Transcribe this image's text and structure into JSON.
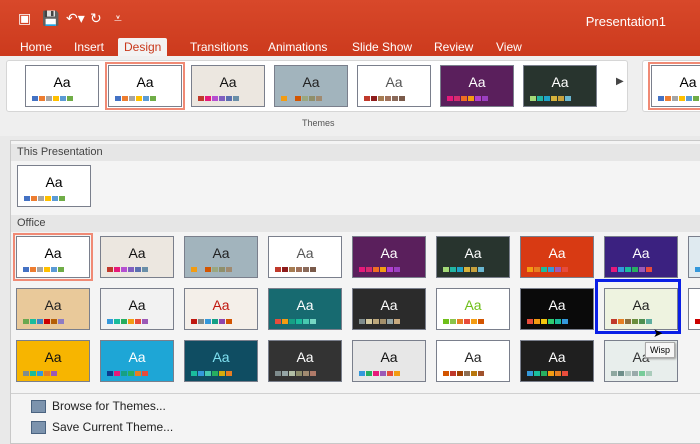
{
  "app": {
    "title": "Presentation1"
  },
  "quick_access": [
    {
      "icon": "sidebar-icon",
      "glyph": "▣"
    },
    {
      "icon": "save-icon",
      "glyph": "💾"
    },
    {
      "icon": "undo-icon",
      "glyph": "↶▾"
    },
    {
      "icon": "redo-icon",
      "glyph": "↻"
    },
    {
      "icon": "customize-icon",
      "glyph": "⩡"
    }
  ],
  "tabs": [
    "Home",
    "Insert",
    "Design",
    "Transitions",
    "Animations",
    "Slide Show",
    "Review",
    "View"
  ],
  "active_tab": "Design",
  "ribbon": {
    "gallery_label": "Themes"
  },
  "panel": {
    "this_presentation": "This Presentation",
    "office": "Office",
    "browse": "Browse for Themes...",
    "save": "Save Current Theme..."
  },
  "tooltip": "Wisp",
  "sample_text": "Aa",
  "themes": [
    {
      "bg": "#ffffff",
      "fg": "#000",
      "sw": [
        "#4472c4",
        "#ed7d31",
        "#a5a5a5",
        "#ffc000",
        "#5b9bd5",
        "#70ad47"
      ]
    },
    {
      "bg": "#ece7e0",
      "fg": "#111",
      "sw": [
        "#c0392b",
        "#e6197a",
        "#b54fd1",
        "#7f5fc0",
        "#5a6fb0",
        "#6a8fa8"
      ]
    },
    {
      "bg": "#a2b4bd",
      "fg": "#222",
      "sw": [
        "#f39c12",
        "#a2b4bd",
        "#d35400",
        "#9aa77f",
        "#8f8f6b",
        "#a08a70"
      ]
    },
    {
      "bg": "#ffffff",
      "fg": "#555",
      "sw": [
        "#c0392b",
        "#8e1c1c",
        "#a67c52",
        "#a0715a",
        "#8a6a5a",
        "#7a5a4a"
      ]
    },
    {
      "bg": "#5a1f5c",
      "fg": "#fff",
      "sw": [
        "#e6197a",
        "#d62b6f",
        "#f06d22",
        "#f39c12",
        "#b13fd1",
        "#9b3fc0"
      ]
    },
    {
      "bg": "#28342e",
      "fg": "#fff",
      "sw": [
        "#a3d977",
        "#22b5a3",
        "#1fa3c9",
        "#d6b23b",
        "#c7a13d",
        "#6ab7d1"
      ]
    },
    {
      "bg": "#d83a13",
      "fg": "#fff",
      "sw": [
        "#f39c12",
        "#e67e22",
        "#1abc9c",
        "#3498db",
        "#9b59b6",
        "#e74c3c"
      ]
    },
    {
      "bg": "#3b2180",
      "fg": "#fff",
      "sw": [
        "#e6197a",
        "#3498db",
        "#1abc9c",
        "#27ae60",
        "#9b59b6",
        "#e74c3c"
      ]
    },
    {
      "bg": "#dfeaf0",
      "fg": "#222",
      "sw": [
        "#3498db",
        "#1abc9c"
      ]
    },
    {
      "bg": "#e9c99a",
      "fg": "#222",
      "sw": [
        "#6aa84f",
        "#1abc9c",
        "#3d85c6",
        "#cc0000",
        "#b45f06",
        "#8e7cc3"
      ]
    },
    {
      "bg": "#f2f2f2",
      "fg": "#111",
      "sw": [
        "#3498db",
        "#1abc9c",
        "#27ae60",
        "#f39c12",
        "#e74c3c",
        "#9b59b6"
      ]
    },
    {
      "bg": "#f4efe9",
      "fg": "#c0170f",
      "sw": [
        "#c0170f",
        "#7f8c8d",
        "#3498db",
        "#16a085",
        "#8e44ad",
        "#d35400"
      ]
    },
    {
      "bg": "#176a70",
      "fg": "#fff",
      "sw": [
        "#e74c3c",
        "#f39c12",
        "#16a085",
        "#1abc9c",
        "#48c9b0",
        "#76d7c4"
      ]
    },
    {
      "bg": "#2b2b2b",
      "fg": "#fff",
      "sw": [
        "#7f8c8d",
        "#d5c9a0",
        "#bca77c",
        "#a38f6b",
        "#95a5a6",
        "#c8a97e"
      ]
    },
    {
      "bg": "#ffffff",
      "fg": "#6fbf1a",
      "sw": [
        "#6fbf1a",
        "#8bc34a",
        "#e67e22",
        "#e74c3c",
        "#f39c12",
        "#d35400"
      ]
    },
    {
      "bg": "#0a0a0a",
      "fg": "#fff",
      "sw": [
        "#e74c3c",
        "#f39c12",
        "#f1c40f",
        "#2ecc71",
        "#1abc9c",
        "#3498db"
      ]
    },
    {
      "bg": "#eef3e0",
      "fg": "#222",
      "sw": [
        "#c0392b",
        "#e67e22",
        "#8b6f3e",
        "#6a8e3e",
        "#4e8f51",
        "#5eae9f"
      ]
    },
    {
      "bg": "#ffffff",
      "fg": "#c00",
      "sw": [
        "#c00"
      ]
    },
    {
      "bg": "#f7b500",
      "fg": "#111",
      "sw": [
        "#7f8c8d",
        "#1abc9c",
        "#3498db",
        "#e67e22",
        "#9b59b6"
      ]
    },
    {
      "bg": "#1ea6d6",
      "fg": "#fff",
      "sw": [
        "#0a3d91",
        "#e6197a",
        "#16a085",
        "#27ae60",
        "#e67e22",
        "#e74c3c"
      ]
    },
    {
      "bg": "#0f4d62",
      "fg": "#7fe0f0",
      "sw": [
        "#1abc9c",
        "#3498db",
        "#48c9b0",
        "#27ae60",
        "#d4ac0d",
        "#e67e22"
      ]
    },
    {
      "bg": "#333333",
      "fg": "#fff",
      "sw": [
        "#7f8c8d",
        "#95a5a6",
        "#b2bfa6",
        "#8d8d6b",
        "#a08a70",
        "#b07a68"
      ]
    },
    {
      "bg": "#e7e7e7",
      "fg": "#111",
      "sw": [
        "#3498db",
        "#27ae60",
        "#e6197a",
        "#9b59b6",
        "#e74c3c",
        "#f39c12"
      ]
    },
    {
      "bg": "#ffffff",
      "fg": "#222",
      "sw": [
        "#d35400",
        "#c0392b",
        "#a04000",
        "#8e6e53",
        "#b9770e",
        "#a0522d"
      ]
    },
    {
      "bg": "#1f1f1f",
      "fg": "#fff",
      "sw": [
        "#3498db",
        "#1abc9c",
        "#27ae60",
        "#f39c12",
        "#e67e22",
        "#e74c3c"
      ]
    },
    {
      "bg": "#e8eeec",
      "fg": "#333",
      "sw": [
        "#8fa8a0",
        "#6f8f8a",
        "#b0c4be",
        "#9aa",
        "#7c9",
        "#acb"
      ]
    }
  ],
  "ribbon_themes": [
    0,
    0,
    1,
    2,
    3,
    4,
    5
  ],
  "grid": [
    [
      0,
      1,
      2,
      3,
      4,
      5,
      6,
      7,
      8
    ],
    [
      9,
      10,
      11,
      12,
      13,
      14,
      15,
      16,
      17
    ],
    [
      18,
      19,
      20,
      21,
      22,
      23,
      24,
      25
    ]
  ],
  "selected_theme": "Office Theme",
  "hovered_theme": "Wisp"
}
